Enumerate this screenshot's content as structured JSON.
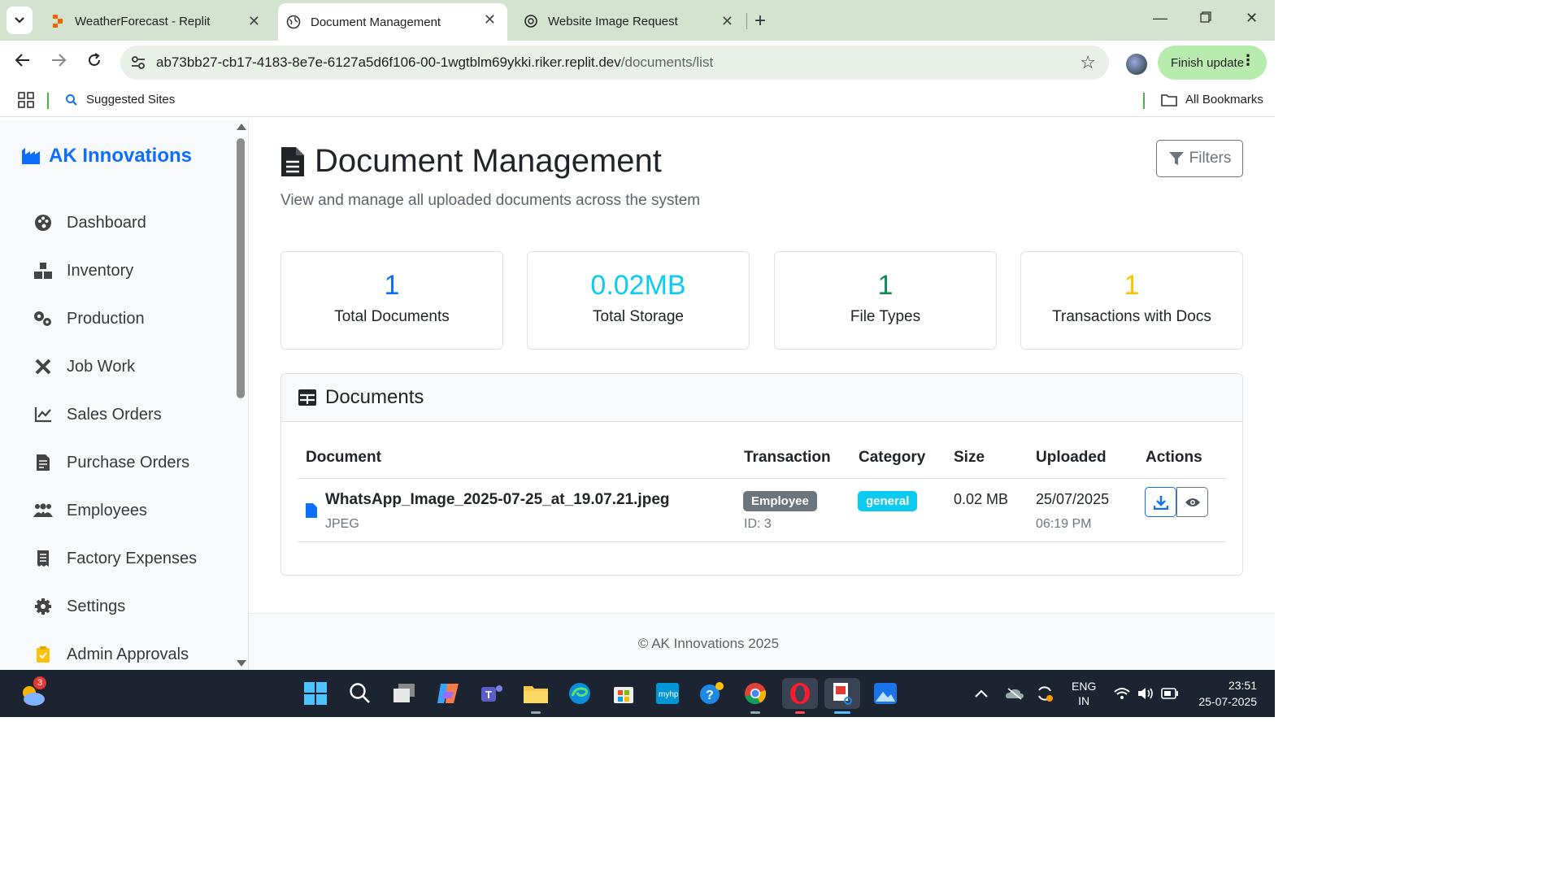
{
  "browser": {
    "tabs": [
      {
        "title": "WeatherForecast - Replit",
        "active": false
      },
      {
        "title": "Document Management",
        "active": true
      },
      {
        "title": "Website Image Request",
        "active": false
      }
    ],
    "url_host": "ab73bb27-cb17-4183-8e7e-6127a5d6f106-00-1wgtblm69ykki.riker.replit.dev",
    "url_path": "/documents/list",
    "finish_update_label": "Finish update",
    "bookmarks": {
      "suggested": "Suggested Sites",
      "all": "All Bookmarks"
    }
  },
  "sidebar": {
    "brand": "AK Innovations",
    "items": [
      {
        "label": "Dashboard",
        "icon": "palette-icon"
      },
      {
        "label": "Inventory",
        "icon": "boxes-icon"
      },
      {
        "label": "Production",
        "icon": "gears-icon"
      },
      {
        "label": "Job Work",
        "icon": "tools-icon"
      },
      {
        "label": "Sales Orders",
        "icon": "chart-line-icon"
      },
      {
        "label": "Purchase Orders",
        "icon": "file-invoice-icon"
      },
      {
        "label": "Employees",
        "icon": "users-icon"
      },
      {
        "label": "Factory Expenses",
        "icon": "receipt-icon"
      },
      {
        "label": "Settings",
        "icon": "gear-icon"
      },
      {
        "label": "Admin Approvals",
        "icon": "clipboard-check-icon"
      }
    ]
  },
  "page": {
    "title": "Document Management",
    "subtitle": "View and manage all uploaded documents across the system",
    "filters_label": "Filters"
  },
  "stats": [
    {
      "value": "1",
      "label": "Total Documents",
      "color": "#0d6efd"
    },
    {
      "value": "0.02MB",
      "label": "Total Storage",
      "color": "#0dcaf0"
    },
    {
      "value": "1",
      "label": "File Types",
      "color": "#198754"
    },
    {
      "value": "1",
      "label": "Transactions with Docs",
      "color": "#ffc107"
    }
  ],
  "documents": {
    "heading": "Documents",
    "columns": [
      "Document",
      "Transaction",
      "Category",
      "Size",
      "Uploaded",
      "Actions"
    ],
    "rows": [
      {
        "name": "WhatsApp_Image_2025-07-25_at_19.07.21.jpeg",
        "type": "JPEG",
        "transaction": "Employee",
        "transaction_id": "ID: 3",
        "category": "general",
        "size": "0.02 MB",
        "date": "25/07/2025",
        "time": "06:19 PM"
      }
    ]
  },
  "footer": "© AK Innovations 2025",
  "taskbar": {
    "weather_badge": "3",
    "lang": "ENG",
    "region": "IN",
    "time": "23:51",
    "date": "25-07-2025"
  },
  "colors": {
    "primary": "#0d6efd",
    "info": "#0dcaf0",
    "success": "#198754",
    "warning": "#ffc107",
    "secondary": "#6c757d"
  }
}
